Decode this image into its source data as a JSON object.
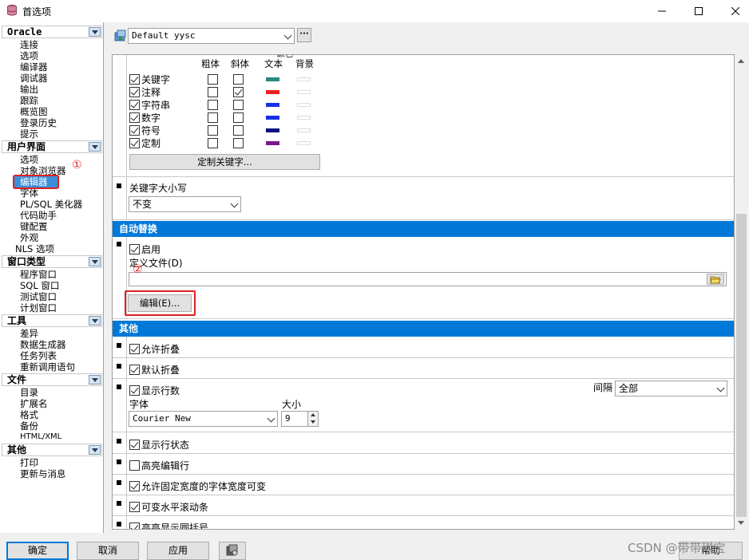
{
  "window": {
    "title": "首选项",
    "minimize": "—",
    "maximize": "☐",
    "close": "✕"
  },
  "sidebar": {
    "categories": [
      {
        "label": "Oracle",
        "items": [
          "连接",
          "选项",
          "编译器",
          "调试器",
          "输出",
          "跟踪",
          "概览图",
          "登录历史",
          "提示"
        ]
      },
      {
        "label": "用户界面",
        "items": [
          "选项",
          "对象浏览器",
          "编辑器",
          "字体",
          "PL/SQL 美化器",
          "代码助手",
          "键配置",
          "外观",
          "NLS 选项"
        ]
      },
      {
        "label": "窗口类型",
        "items": [
          "程序窗口",
          "SQL 窗口",
          "测试窗口",
          "计划窗口"
        ]
      },
      {
        "label": "工具",
        "items": [
          "差异",
          "数据生成器",
          "任务列表",
          "重新调用语句"
        ]
      },
      {
        "label": "文件",
        "items": [
          "目录",
          "扩展名",
          "格式",
          "备份",
          "HTML/XML"
        ]
      },
      {
        "label": "其他",
        "items": [
          "打印",
          "更新与消息"
        ]
      }
    ],
    "selected": "编辑器"
  },
  "annotations": {
    "one": "①",
    "two": "②"
  },
  "profile": {
    "value": "Default yysc",
    "more": "···"
  },
  "syntax": {
    "headers": {
      "bold": "粗体",
      "italic": "斜体",
      "text": "文本",
      "bg": "背景",
      "partial": "颜色"
    },
    "rows": [
      {
        "label": "关键字",
        "enabled": true,
        "bold": false,
        "italic": false,
        "color": "#2a8a80"
      },
      {
        "label": "注释",
        "enabled": true,
        "bold": false,
        "italic": true,
        "color": "#e82020"
      },
      {
        "label": "字符串",
        "enabled": true,
        "bold": false,
        "italic": false,
        "color": "#1a2ee8"
      },
      {
        "label": "数字",
        "enabled": true,
        "bold": false,
        "italic": false,
        "color": "#1a2ee8"
      },
      {
        "label": "符号",
        "enabled": true,
        "bold": false,
        "italic": false,
        "color": "#0a1480"
      },
      {
        "label": "定制",
        "enabled": true,
        "bold": false,
        "italic": false,
        "color": "#7a1890"
      }
    ],
    "custom_keywords_button": "定制关键字..."
  },
  "keyword_case": {
    "label": "关键字大小写",
    "value": "不变"
  },
  "autoreplace": {
    "section": "自动替换",
    "enabled_label": "启用",
    "definition_label": "定义文件(D)",
    "definition_value": "",
    "edit_button": "编辑(E)..."
  },
  "other": {
    "section": "其他",
    "allow_folding": "允许折叠",
    "default_folding": "默认折叠",
    "show_line_numbers": "显示行数",
    "interval_label": "间隔",
    "interval_value": "全部",
    "font_label": "字体",
    "font_value": "Courier New",
    "size_label": "大小",
    "size_value": "9",
    "show_line_status": "显示行状态",
    "highlight_edit_line": "高亮编辑行",
    "allow_fixed_width": "允许固定宽度的字体宽度可变",
    "variable_hscroll": "可变水平滚动条",
    "highlight_brackets": "高亮显示圆括号"
  },
  "buttons": {
    "ok": "确定",
    "cancel": "取消",
    "apply": "应用",
    "help": "帮助"
  },
  "watermark": "CSDN @带带琪宝"
}
